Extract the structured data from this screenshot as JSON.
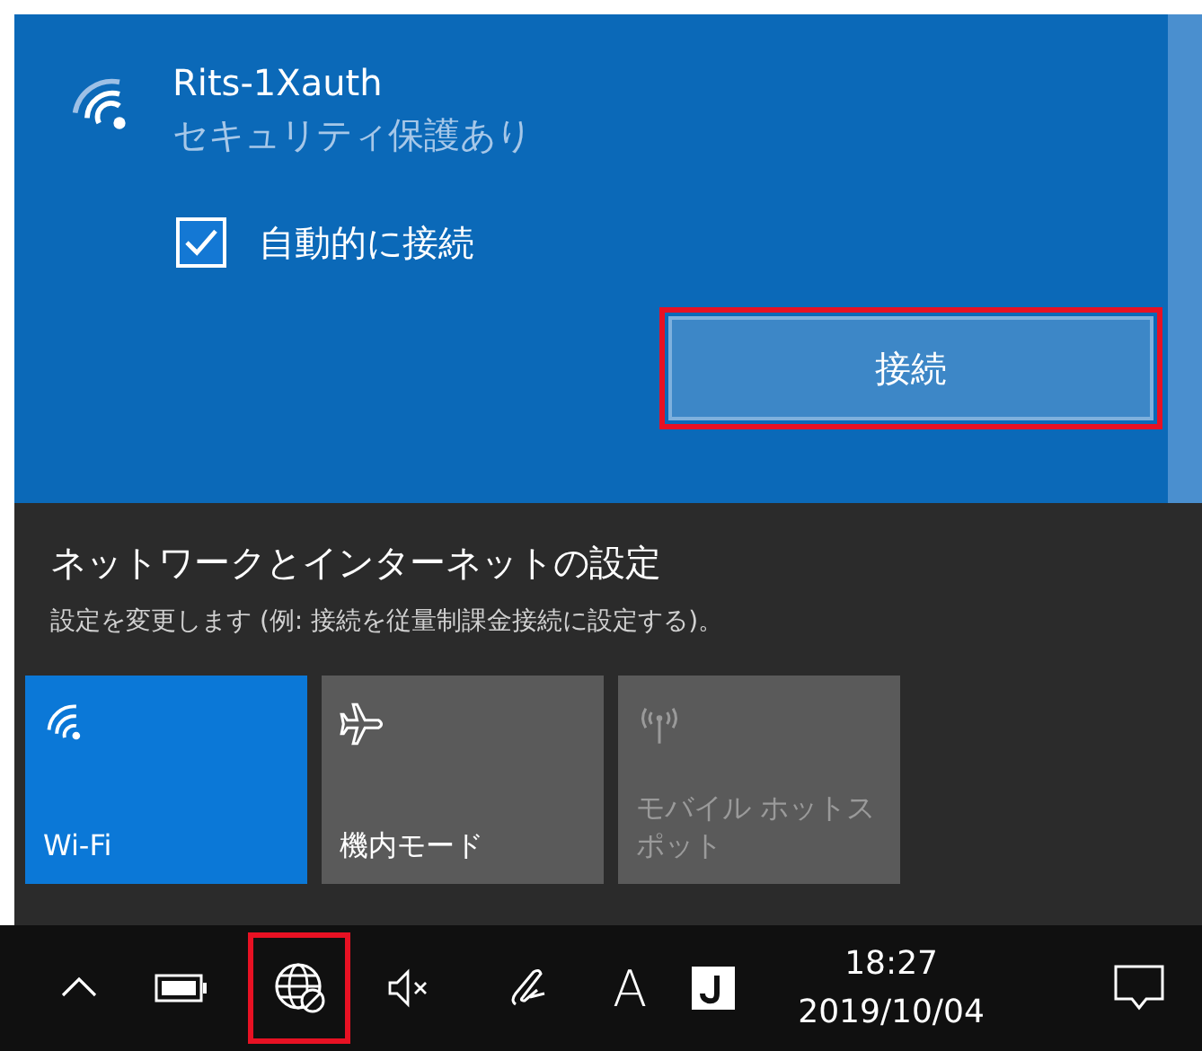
{
  "network": {
    "name": "Rits-1Xauth",
    "security": "セキュリティ保護あり",
    "auto_connect": {
      "label": "自動的に接続",
      "checked": true
    },
    "connect_button": "接続"
  },
  "settings": {
    "title": "ネットワークとインターネットの設定",
    "description": "設定を変更します (例: 接続を従量制課金接続に設定する)。"
  },
  "tiles": [
    {
      "kind": "wifi",
      "label": "Wi-Fi",
      "on": true,
      "disabled": false
    },
    {
      "kind": "airplane",
      "label": "機内モード",
      "on": false,
      "disabled": false
    },
    {
      "kind": "hotspot",
      "label": "モバイル ホットスポット",
      "on": false,
      "disabled": true
    }
  ],
  "taskbar": {
    "ime_mode": "A",
    "time": "18:27",
    "date": "2019/10/04"
  }
}
